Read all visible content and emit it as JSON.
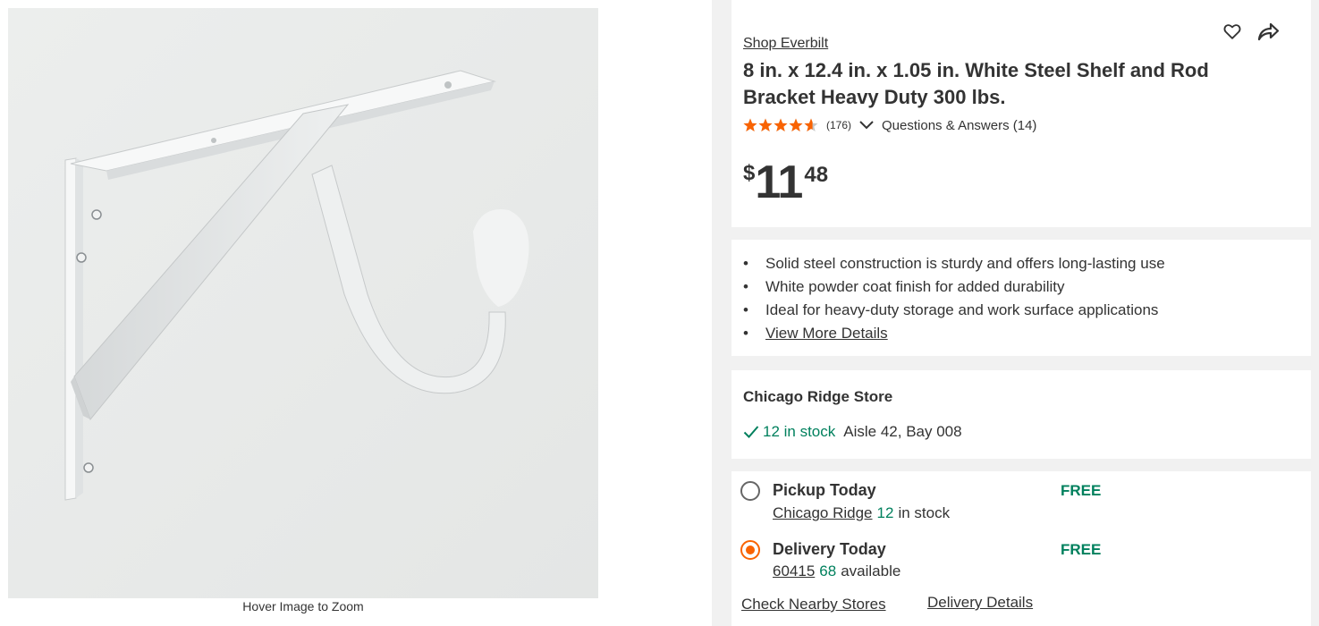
{
  "gallery": {
    "image_alt": "8 in. x 12.4 in. x 1.05 in. White Steel Shelf and Rod Bracket",
    "zoom_hint": "Hover Image to Zoom"
  },
  "product": {
    "brand_link": "Shop Everbilt",
    "title": "8 in. x 12.4 in. x 1.05 in. White Steel Shelf and Rod Bracket Heavy Duty 300 lbs.",
    "rating": 4.6,
    "review_count": "(176)",
    "qa_link": "Questions & Answers (14)",
    "price": {
      "dollar_sign": "$",
      "whole": "11",
      "cents": "48"
    }
  },
  "actions": {
    "favorite_icon": "heart-icon",
    "share_icon": "share-icon"
  },
  "highlights": {
    "bullets": [
      "Solid steel construction is sturdy and offers long-lasting use",
      "White powder coat finish for added durability",
      "Ideal for heavy-duty storage and work surface applications"
    ],
    "more_link": "View More Details"
  },
  "store": {
    "name": "Chicago Ridge Store",
    "stock": "12 in stock",
    "aisle": "Aisle 42, Bay 008"
  },
  "fulfillment": {
    "pickup": {
      "title": "Pickup Today",
      "price": "FREE",
      "store_link": "Chicago Ridge",
      "qty": "12",
      "qty_suffix": "in stock",
      "selected": false
    },
    "delivery": {
      "title": "Delivery Today",
      "price": "FREE",
      "zip_link": "60415",
      "qty": "68",
      "qty_suffix": "available",
      "selected": true
    },
    "nearby_link": "Check Nearby Stores",
    "delivery_details_link": "Delivery Details"
  },
  "colors": {
    "accent_orange": "#f96302",
    "stock_green": "#00805d",
    "text": "#333333",
    "panel_bg": "#f1f1f1"
  }
}
